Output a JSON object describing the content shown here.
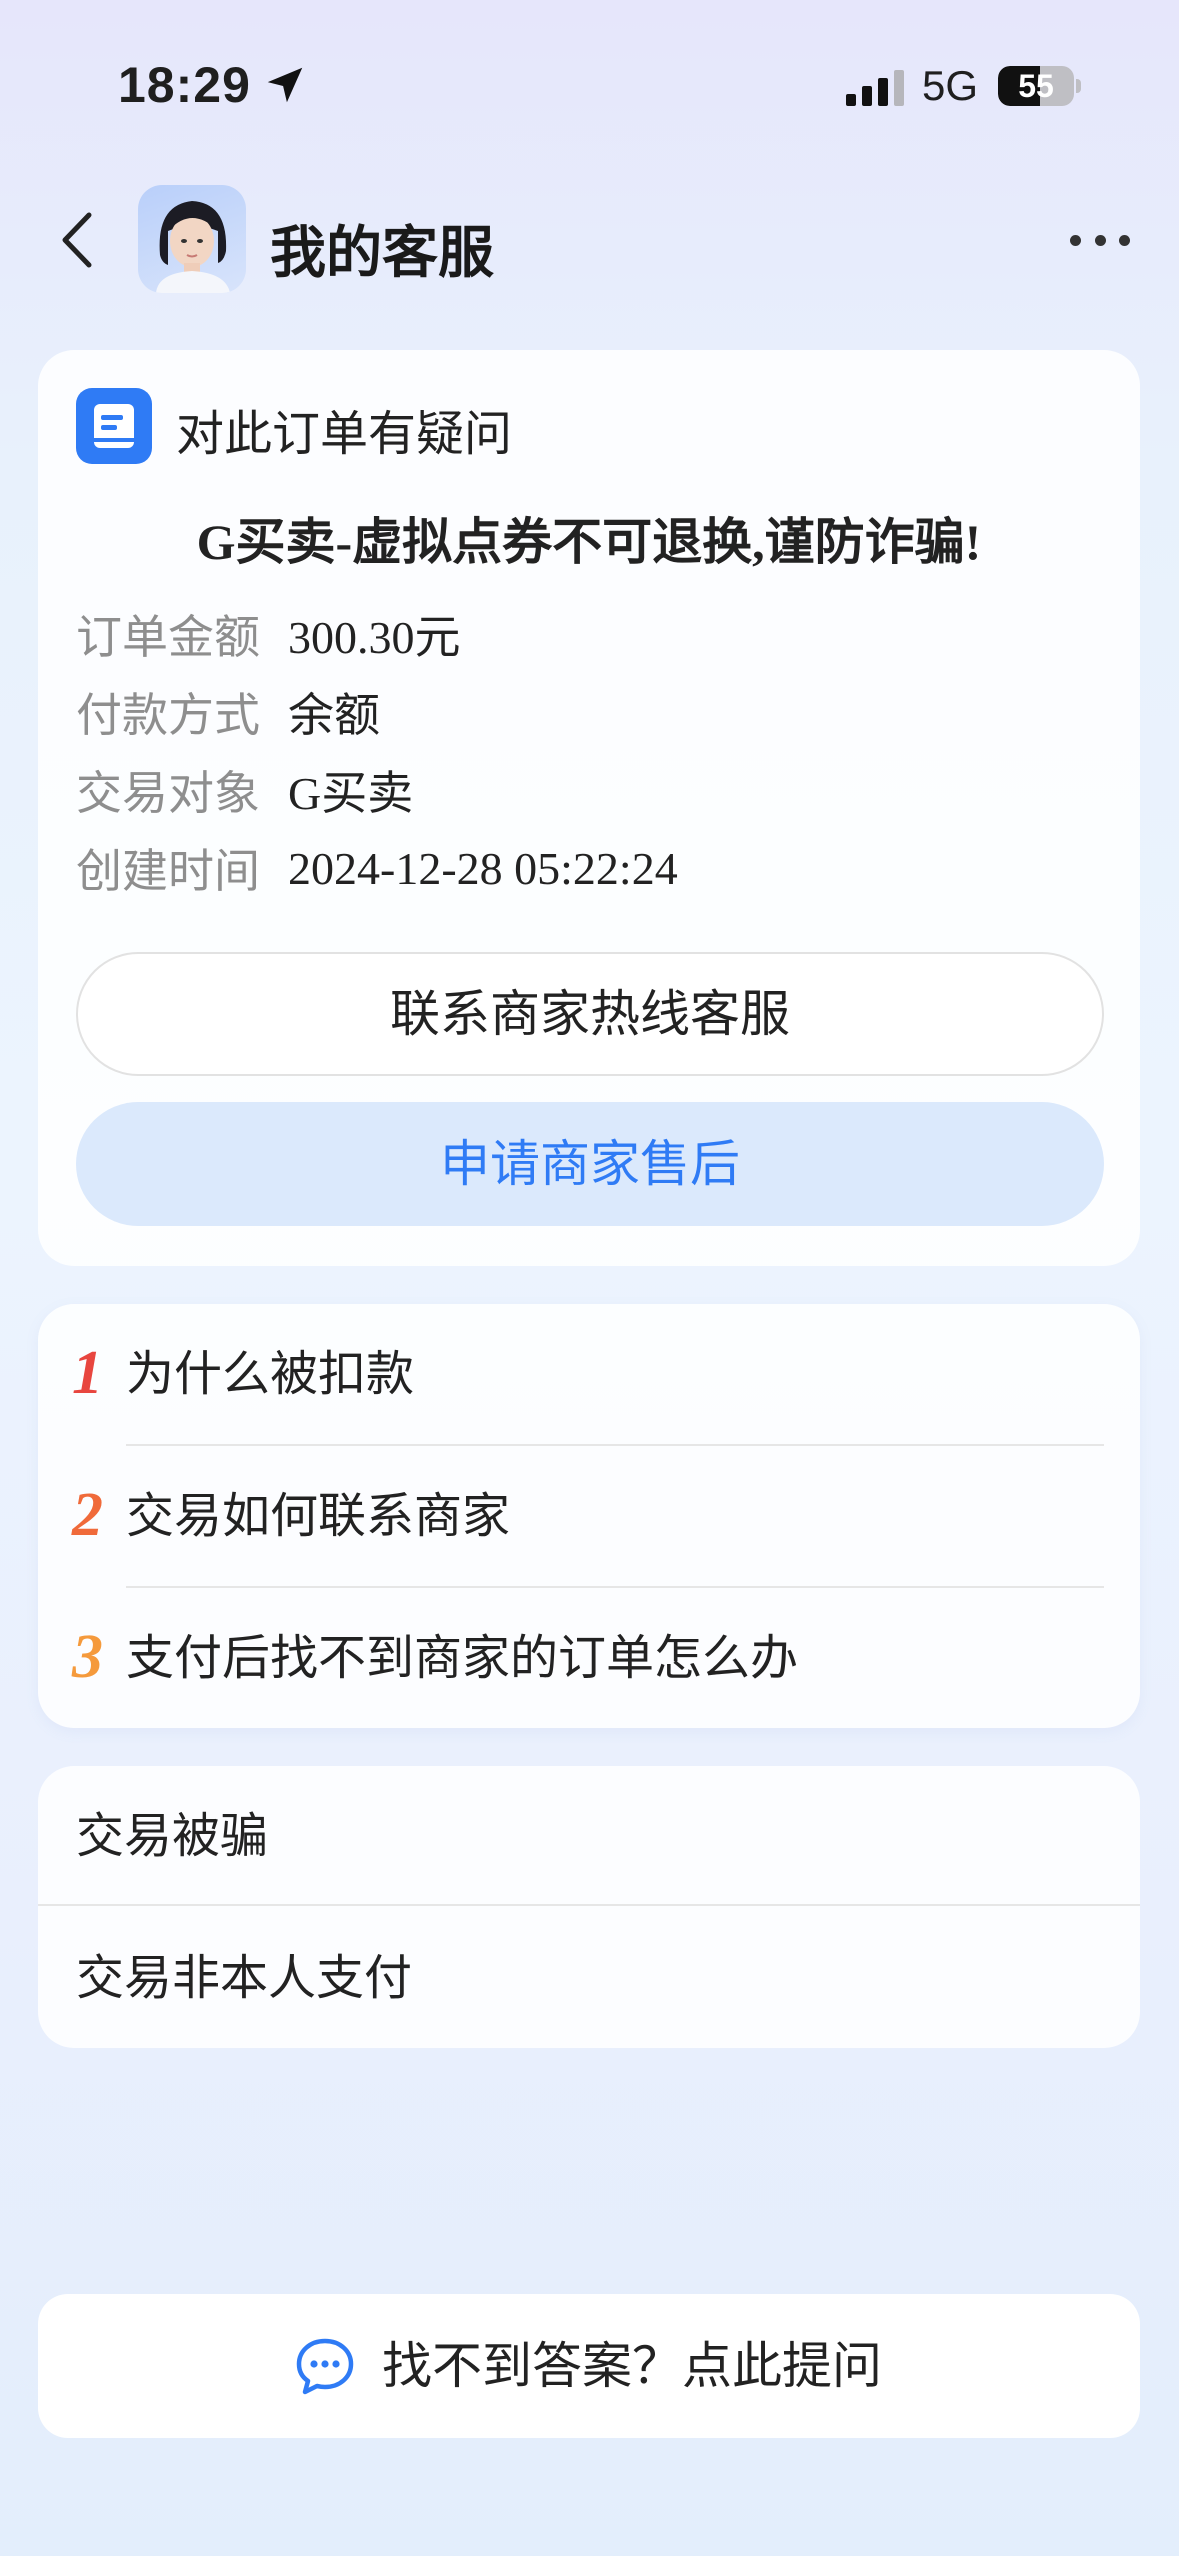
{
  "status_bar": {
    "time": "18:29",
    "network": "5G",
    "battery_level": "55",
    "battery_fraction": 0.55
  },
  "nav": {
    "title": "我的客服"
  },
  "order": {
    "header": "对此订单有疑问",
    "banner": "G买卖-虚拟点券不可退换,谨防诈骗!",
    "details": [
      {
        "label": "订单金额",
        "value": "300.30元"
      },
      {
        "label": "付款方式",
        "value": "余额"
      },
      {
        "label": "交易对象",
        "value": "G买卖"
      },
      {
        "label": "创建时间",
        "value": "2024-12-28 05:22:24"
      }
    ],
    "contact_button": "联系商家热线客服",
    "aftersale_button": "申请商家售后"
  },
  "faq": [
    {
      "num": "1",
      "text": "为什么被扣款",
      "color": "#e8463f"
    },
    {
      "num": "2",
      "text": "交易如何联系商家",
      "color": "#f06a3a"
    },
    {
      "num": "3",
      "text": "支付后找不到商家的订单怎么办",
      "color": "#f59a3c"
    }
  ],
  "topics": [
    {
      "text": "交易被骗"
    },
    {
      "text": "交易非本人支付"
    }
  ],
  "ask": {
    "label": "找不到答案？点此提问"
  },
  "colors": {
    "accent": "#2f7bf5",
    "accent_light": "#dbe9fc"
  },
  "icons": {
    "back": "chevron-left-icon",
    "more": "more-dots-icon",
    "location": "location-arrow-icon",
    "signal": "cellular-signal-icon",
    "document": "document-icon",
    "chat": "chat-bubble-icon"
  }
}
